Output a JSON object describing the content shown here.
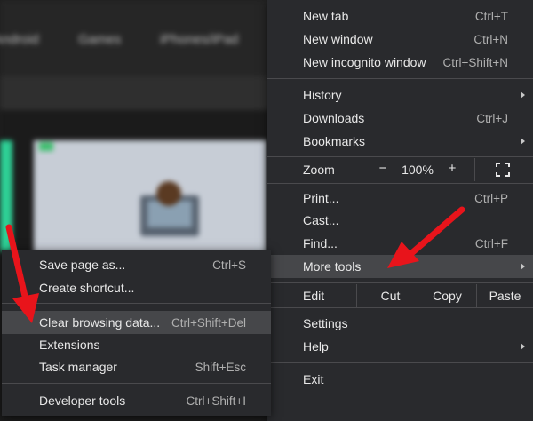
{
  "background": {
    "nav_items": [
      "Android",
      "Games",
      "iPhones/iPad"
    ]
  },
  "main_menu": {
    "new_tab": {
      "label": "New tab",
      "shortcut": "Ctrl+T"
    },
    "new_window": {
      "label": "New window",
      "shortcut": "Ctrl+N"
    },
    "new_incognito": {
      "label": "New incognito window",
      "shortcut": "Ctrl+Shift+N"
    },
    "history": {
      "label": "History"
    },
    "downloads": {
      "label": "Downloads",
      "shortcut": "Ctrl+J"
    },
    "bookmarks": {
      "label": "Bookmarks"
    },
    "zoom": {
      "label": "Zoom",
      "minus": "−",
      "value": "100%",
      "plus": "+"
    },
    "print": {
      "label": "Print...",
      "shortcut": "Ctrl+P"
    },
    "cast": {
      "label": "Cast..."
    },
    "find": {
      "label": "Find...",
      "shortcut": "Ctrl+F"
    },
    "more_tools": {
      "label": "More tools"
    },
    "edit": {
      "label": "Edit",
      "cut": "Cut",
      "copy": "Copy",
      "paste": "Paste"
    },
    "settings": {
      "label": "Settings"
    },
    "help": {
      "label": "Help"
    },
    "exit": {
      "label": "Exit"
    }
  },
  "sub_menu": {
    "save_page": {
      "label": "Save page as...",
      "shortcut": "Ctrl+S"
    },
    "create_shortcut": {
      "label": "Create shortcut..."
    },
    "clear_data": {
      "label": "Clear browsing data...",
      "shortcut": "Ctrl+Shift+Del"
    },
    "extensions": {
      "label": "Extensions"
    },
    "task_manager": {
      "label": "Task manager",
      "shortcut": "Shift+Esc"
    },
    "developer_tools": {
      "label": "Developer tools",
      "shortcut": "Ctrl+Shift+I"
    }
  },
  "colors": {
    "menu_bg": "#292a2d",
    "highlight": "#46474a",
    "arrow_red": "#e8141b"
  },
  "icons": [
    "fullscreen-icon",
    "submenu-arrow-icon",
    "red-pointer-arrow-icon"
  ]
}
